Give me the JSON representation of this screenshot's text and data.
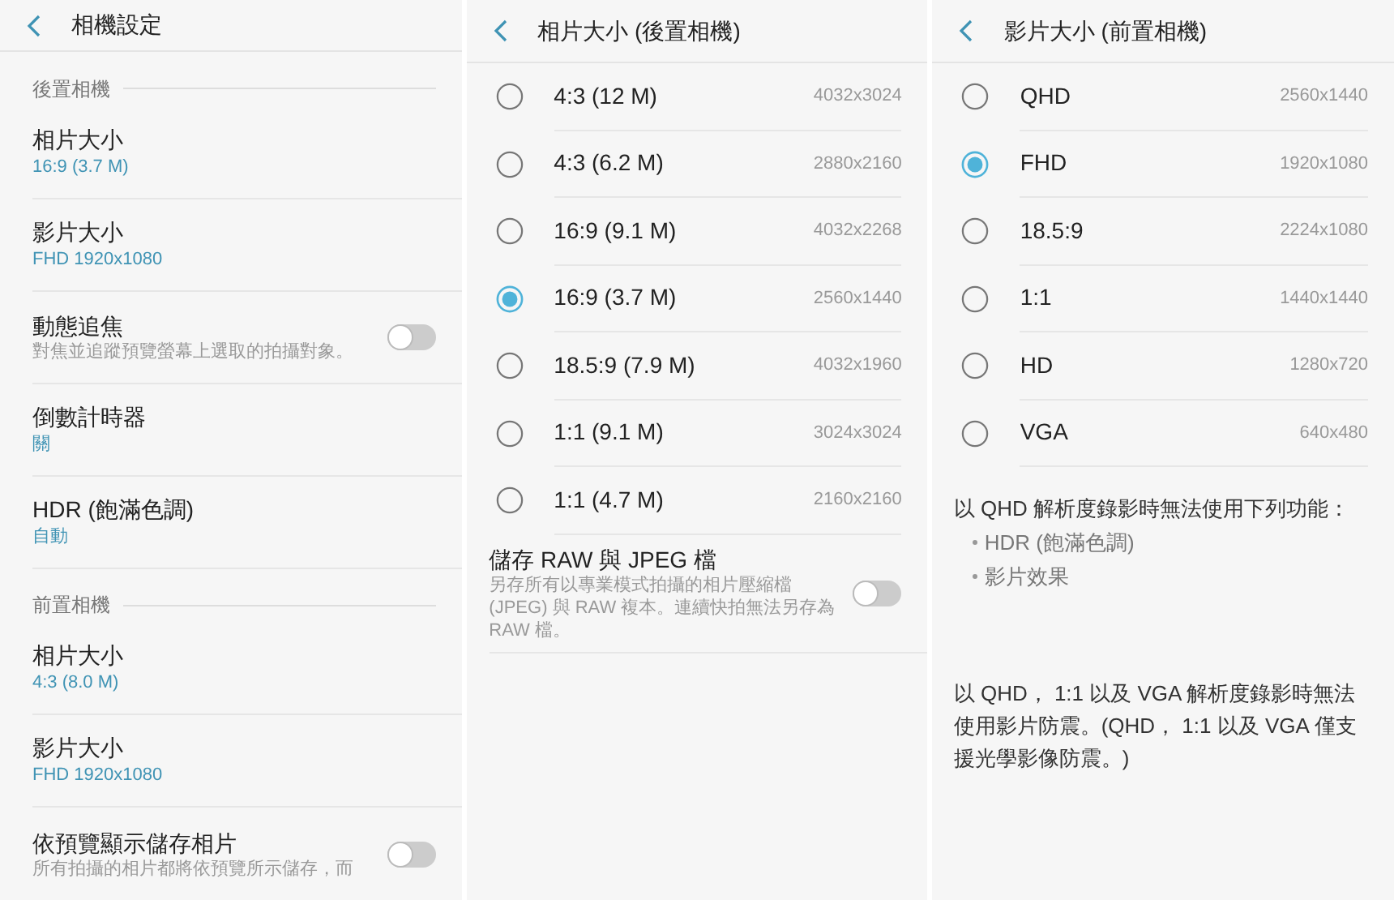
{
  "panels": [
    {
      "title": "相機設定",
      "sections": [
        {
          "label": "後置相機",
          "items": [
            {
              "kind": "value",
              "title": "相片大小",
              "value": "16:9 (3.7 M)"
            },
            {
              "kind": "value",
              "title": "影片大小",
              "value": "FHD 1920x1080"
            },
            {
              "kind": "toggle",
              "title": "動態追焦",
              "description": "對焦並追蹤預覽螢幕上選取的拍攝對象。",
              "on": false
            },
            {
              "kind": "value",
              "title": "倒數計時器",
              "value": "關"
            },
            {
              "kind": "value",
              "title": "HDR (飽滿色調)",
              "value": "自動"
            }
          ]
        },
        {
          "label": "前置相機",
          "items": [
            {
              "kind": "value",
              "title": "相片大小",
              "value": "4:3 (8.0 M)"
            },
            {
              "kind": "value",
              "title": "影片大小",
              "value": "FHD 1920x1080"
            },
            {
              "kind": "toggle",
              "title": "依預覽顯示儲存相片",
              "description": "所有拍攝的相片都將依預覽所示儲存，而",
              "on": false
            }
          ]
        }
      ]
    },
    {
      "title": "相片大小 (後置相機)",
      "options": [
        {
          "label": "4:3 (12 M)",
          "resolution": "4032x3024",
          "selected": false
        },
        {
          "label": "4:3 (6.2 M)",
          "resolution": "2880x2160",
          "selected": false
        },
        {
          "label": "16:9 (9.1 M)",
          "resolution": "4032x2268",
          "selected": false
        },
        {
          "label": "16:9 (3.7 M)",
          "resolution": "2560x1440",
          "selected": true
        },
        {
          "label": "18.5:9 (7.9 M)",
          "resolution": "4032x1960",
          "selected": false
        },
        {
          "label": "1:1 (9.1 M)",
          "resolution": "3024x3024",
          "selected": false
        },
        {
          "label": "1:1 (4.7 M)",
          "resolution": "2160x2160",
          "selected": false
        }
      ],
      "items": [
        {
          "kind": "toggle",
          "title": "儲存 RAW 與 JPEG 檔",
          "description": "另存所有以專業模式拍攝的相片壓縮檔 (JPEG) 與 RAW 複本。連續快拍無法另存為 RAW 檔。",
          "on": false
        }
      ]
    },
    {
      "title": "影片大小 (前置相機)",
      "options": [
        {
          "label": "QHD",
          "resolution": "2560x1440",
          "selected": false
        },
        {
          "label": "FHD",
          "resolution": "1920x1080",
          "selected": true
        },
        {
          "label": "18.5:9",
          "resolution": "2224x1080",
          "selected": false
        },
        {
          "label": "1:1",
          "resolution": "1440x1440",
          "selected": false
        },
        {
          "label": "HD",
          "resolution": "1280x720",
          "selected": false
        },
        {
          "label": "VGA",
          "resolution": "640x480",
          "selected": false
        }
      ],
      "notes": [
        {
          "kind": "paragraph",
          "text": "以 QHD 解析度錄影時無法使用下列功能："
        },
        {
          "kind": "bullet",
          "text": "HDR (飽滿色調)"
        },
        {
          "kind": "bullet",
          "text": "影片效果"
        },
        {
          "kind": "paragraph",
          "text": "以 QHD， 1:1 以及 VGA 解析度錄影時無法使用影片防震。(QHD， 1:1 以及 VGA 僅支援光學影像防震。)"
        }
      ]
    }
  ]
}
